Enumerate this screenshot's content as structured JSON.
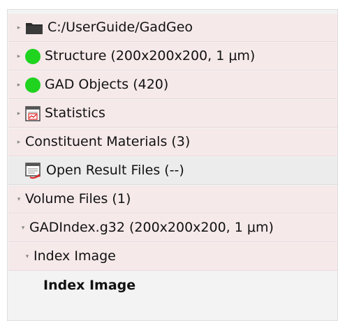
{
  "tree": {
    "items": [
      {
        "label": "C:/UserGuide/GadGeo",
        "icon": "folder-icon",
        "state": "collapsed"
      },
      {
        "label": "Structure (200x200x200, 1 μm)",
        "icon": "status-ok-icon",
        "state": "collapsed"
      },
      {
        "label": "GAD Objects (420)",
        "icon": "status-ok-icon",
        "state": "collapsed"
      },
      {
        "label": "Statistics",
        "icon": "statistics-icon",
        "state": "collapsed"
      },
      {
        "label": "Constituent Materials (3)",
        "icon": "",
        "state": "collapsed"
      },
      {
        "label": "Open Result Files (--)",
        "icon": "open-result-files-icon",
        "state": "leaf"
      },
      {
        "label": "Volume Files (1)",
        "icon": "",
        "state": "expanded"
      },
      {
        "label": "GADIndex.g32 (200x200x200, 1 μm)",
        "icon": "",
        "state": "expanded"
      },
      {
        "label": "Index Image",
        "icon": "",
        "state": "expanded"
      },
      {
        "label": "Index Image",
        "icon": "",
        "state": "leaf"
      }
    ]
  },
  "colors": {
    "status_green": "#1fd31f",
    "row_pink": "#f6e9ea",
    "row_gray": "#ececec"
  }
}
